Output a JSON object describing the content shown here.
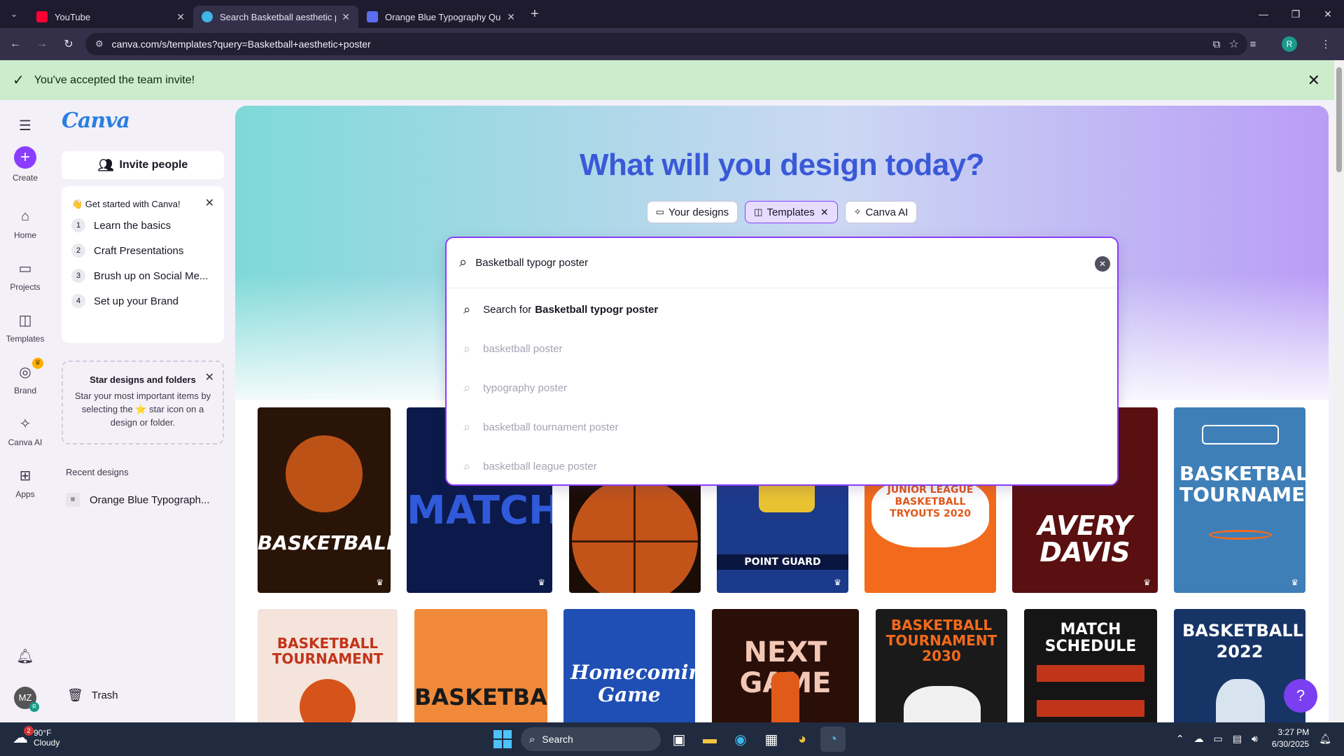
{
  "browser": {
    "tabs": [
      {
        "title": "YouTube",
        "fav_color": "#ff0033",
        "active": false
      },
      {
        "title": "Search Basketball aesthetic pos",
        "fav_color": "#3fb6e8",
        "active": true
      },
      {
        "title": "Orange Blue Typography Quote",
        "fav_color": "#5a6cf0",
        "active": false
      }
    ],
    "url": "canva.com/s/templates?query=Basketball+aesthetic+poster",
    "profile_initial": "R"
  },
  "notice": {
    "text": "You've accepted the team invite!"
  },
  "rail": {
    "create": "Create",
    "home": "Home",
    "projects": "Projects",
    "templates": "Templates",
    "brand": "Brand",
    "canva_ai": "Canva AI",
    "apps": "Apps",
    "avatar_initials": "MZ",
    "avatar_sub": "R"
  },
  "panel": {
    "logo": "Canva",
    "invite": "Invite people",
    "get_started": {
      "heading": "👋 Get started with Canva!",
      "items": [
        {
          "n": "1",
          "label": "Learn the basics"
        },
        {
          "n": "2",
          "label": "Craft Presentations"
        },
        {
          "n": "3",
          "label": "Brush up on Social Me..."
        },
        {
          "n": "4",
          "label": "Set up your Brand"
        }
      ]
    },
    "stars": {
      "heading": "Star designs and folders",
      "body": "Star your most important items by selecting the ⭐ star icon on a design or folder."
    },
    "recent_label": "Recent designs",
    "recent_item": "Orange Blue Typograph...",
    "trash": "Trash"
  },
  "main": {
    "title": "What will you design today?",
    "pills": {
      "your_designs": "Your designs",
      "templates": "Templates",
      "canva_ai": "Canva AI"
    },
    "search": {
      "value": "Basketball typogr poster",
      "first_prefix": "Search for",
      "first_query": "Basketball typogr poster",
      "suggestions": [
        "basketball poster",
        "typography poster",
        "basketball tournament poster",
        "basketball league poster"
      ]
    },
    "tiles_row1": [
      {
        "text": "BASKETBALL",
        "bg": "#2a1408"
      },
      {
        "text": "MATCH",
        "bg": "#0b1a4a"
      },
      {
        "text": "",
        "bg": "#b04a12"
      },
      {
        "text": "POINT GUARD",
        "bg": "#1c3a8a"
      },
      {
        "text": "JUNIOR LEAGUE BASKETBALL TRYOUTS 2020",
        "bg": "#f26a1b"
      },
      {
        "text": "AVERY DAVIS",
        "bg": "#5a1010"
      },
      {
        "text": "BASKETBALL TOURNAMENT",
        "bg": "#3f7fb8"
      }
    ],
    "tiles_row2": [
      {
        "text": "BASKETBALL TOURNAMENT",
        "bg": "#f4e4dc"
      },
      {
        "text": "BASKETBALL",
        "bg": "#f08a3a"
      },
      {
        "text": "Homecoming Game",
        "bg": "#1f4fb4"
      },
      {
        "text": "NEXT GAME",
        "bg": "#2a0e08"
      },
      {
        "text": "BASKETBALL TOURNAMENT 2030",
        "bg": "#1a1a1a"
      },
      {
        "text": "MATCH SCHEDULE",
        "bg": "#151515"
      },
      {
        "text": "BASKETBALL 2022",
        "bg": "#163466"
      }
    ]
  },
  "taskbar": {
    "temp": "90°F",
    "cond": "Cloudy",
    "weather_badge": "2",
    "search": "Search",
    "time": "3:27 PM",
    "date": "6/30/2025"
  }
}
